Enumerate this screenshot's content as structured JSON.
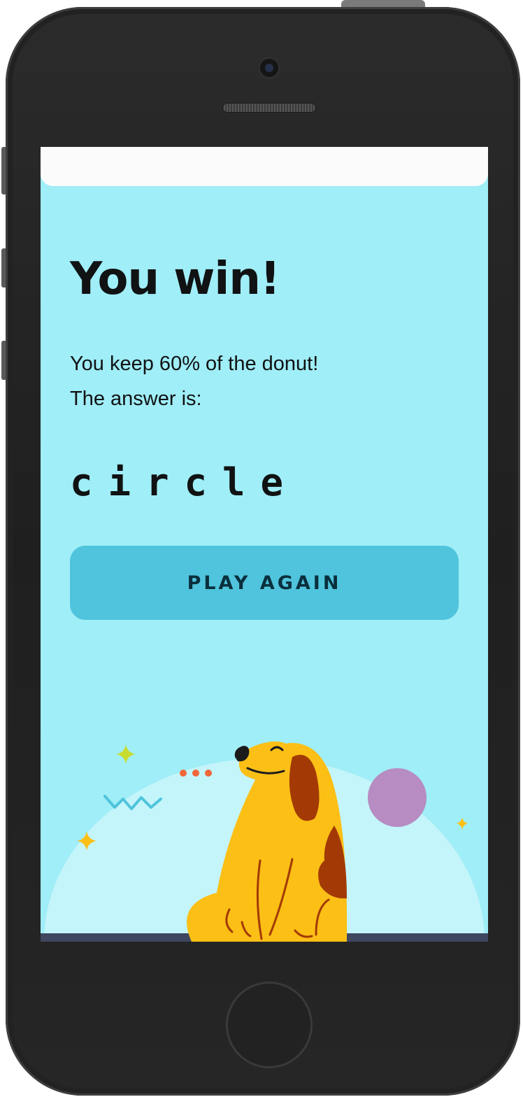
{
  "result": {
    "title": "You win!",
    "message_line1": "You keep 60% of the donut!",
    "message_line2": "The answer is:",
    "answer": "circle",
    "play_again_label": "PLAY AGAIN"
  },
  "colors": {
    "screen_background": "#a0eef7",
    "button_background": "#4fc4dc",
    "button_text": "#0a2f3d",
    "dog_body": "#fbbf16",
    "dog_spots": "#a33a05",
    "planet": "#b78cc3"
  },
  "icons": [
    "sparkle-icon",
    "zigzag-icon",
    "dots-icon",
    "dog-illustration"
  ]
}
